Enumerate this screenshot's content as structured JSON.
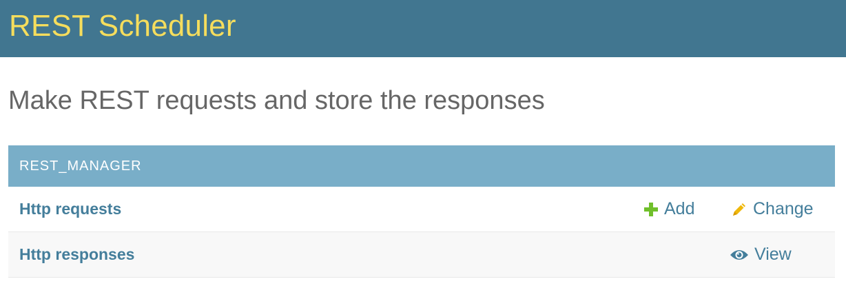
{
  "header": {
    "site_title": "REST Scheduler"
  },
  "page_title": "Make REST requests and store the responses",
  "module": {
    "caption": "REST_MANAGER",
    "rows": [
      {
        "name": "Http requests",
        "actions": [
          {
            "label": "Add",
            "icon": "plus-icon"
          },
          {
            "label": "Change",
            "icon": "pencil-icon"
          }
        ]
      },
      {
        "name": "Http responses",
        "actions": [
          {
            "label": "View",
            "icon": "eye-icon"
          }
        ]
      }
    ]
  },
  "colors": {
    "header_bg": "#417690",
    "site_title": "#f5dd5d",
    "caption_bg": "#79aec8",
    "link": "#447e9b",
    "add_icon": "#70bf2b",
    "change_icon": "#efb80b"
  }
}
